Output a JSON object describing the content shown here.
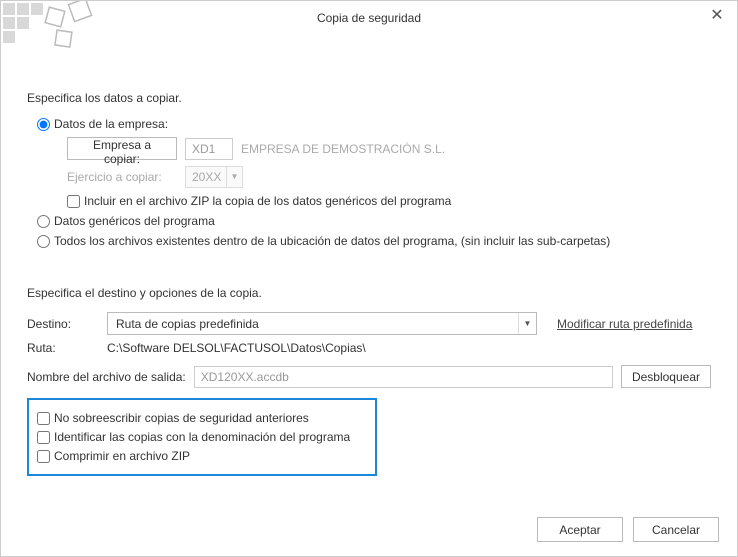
{
  "title": "Copia de seguridad",
  "section1": {
    "heading": "Especifica los datos a copiar.",
    "radio_empresa": "Datos de la empresa:",
    "empresa_copiar_btn": "Empresa a copiar:",
    "empresa_code": "XD1",
    "empresa_name": "EMPRESA DE DEMOSTRACIÓN S.L.",
    "ejercicio_label": "Ejercicio a copiar:",
    "ejercicio_value": "20XX",
    "include_zip": "Incluir en el archivo ZIP la copia de los datos genéricos del programa",
    "radio_genericos": "Datos genéricos del programa",
    "radio_todos": "Todos los archivos existentes dentro de la ubicación de datos del programa, (sin incluir las sub-carpetas)"
  },
  "section2": {
    "heading": "Especifica el destino y opciones de la copia.",
    "destino_label": "Destino:",
    "destino_value": "Ruta de copias predefinida",
    "modificar_link": "Modificar ruta predefinida",
    "ruta_label": "Ruta:",
    "ruta_value": "C:\\Software DELSOL\\FACTUSOL\\Datos\\Copias\\",
    "output_label": "Nombre del archivo de salida:",
    "output_value": "XD120XX.accdb",
    "desbloquear": "Desbloquear",
    "check_overwrite": "No sobreescribir copias de seguridad anteriores",
    "check_identify": "Identificar las copias con la denominación del programa",
    "check_zip": "Comprimir en archivo ZIP"
  },
  "buttons": {
    "accept": "Aceptar",
    "cancel": "Cancelar"
  }
}
